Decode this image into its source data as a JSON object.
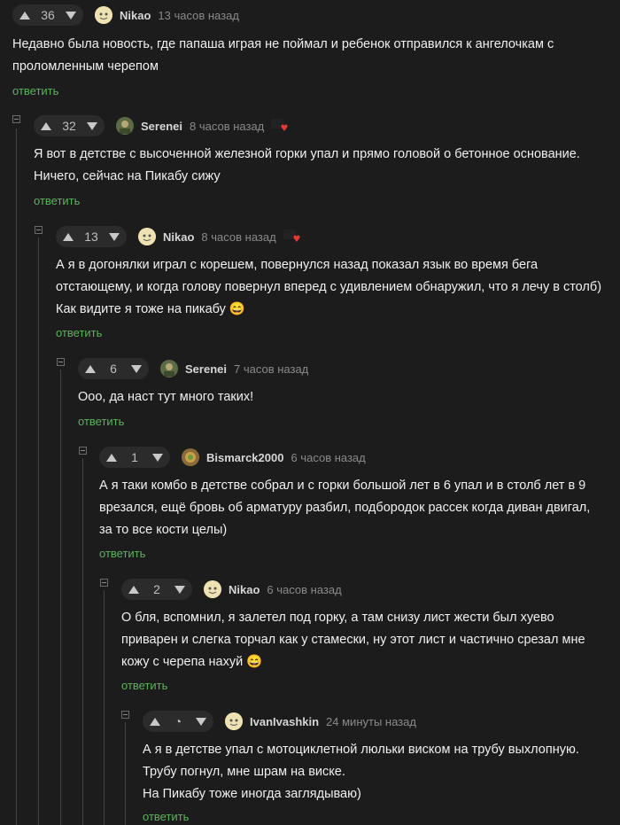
{
  "reply_label": "ответить",
  "comments": [
    {
      "votes": "36",
      "author": "Nikao",
      "time": "13 часов назад",
      "lines": [
        "Недавно была новость, где папаша играя не поймал и ребенок отправился к ангелочкам с",
        "проломленным черепом"
      ]
    },
    {
      "votes": "32",
      "author": "Serenei",
      "time": "8 часов назад",
      "lines": [
        "Я вот в детстве с высоченной железной горки упал и прямо головой о бетонное основание.",
        "Ничего, сейчас на Пикабу сижу"
      ]
    },
    {
      "votes": "13",
      "author": "Nikao",
      "time": "8 часов назад",
      "lines": [
        "А я в догонялки играл с корешем, повернулся назад показал язык во время бега",
        "отстающему, и когда голову повернул вперед с удивлением обнаружил, что я лечу в столб)",
        "Как видите я тоже на пикабу 😄"
      ]
    },
    {
      "votes": "6",
      "author": "Serenei",
      "time": "7 часов назад",
      "lines": [
        "Ооо, да наст тут много таких!"
      ]
    },
    {
      "votes": "1",
      "author": "Bismarck2000",
      "time": "6 часов назад",
      "lines": [
        "А я таки комбо в детстве собрал и с горки большой лет в 6 упал и в столб лет в 9",
        "врезался, ещё бровь об арматуру разбил, подбородок рассек когда диван двигал,",
        "за то все кости целы)"
      ]
    },
    {
      "votes": "2",
      "author": "Nikao",
      "time": "6 часов назад",
      "lines": [
        "О бля, вспомнил, я залетел под горку, а там снизу лист жести был хуево",
        "приварен и слегка торчал как у стамески, ну этот лист и частично срезал мне",
        "кожу с черепа нахуй 😄"
      ]
    },
    {
      "votes": "",
      "author": "IvanIvashkin",
      "time": "24 минуты назад",
      "lines": [
        "А я в детстве упал с мотоциклетной люльки виском на трубу выхлопную.",
        "Трубу погнул, мне шрам на виске.",
        "На Пикабу тоже иногда заглядываю)"
      ]
    }
  ],
  "colors": {
    "background": "#1c1c1c",
    "reply": "#5bb35b",
    "badge_heart": "#e53935"
  }
}
